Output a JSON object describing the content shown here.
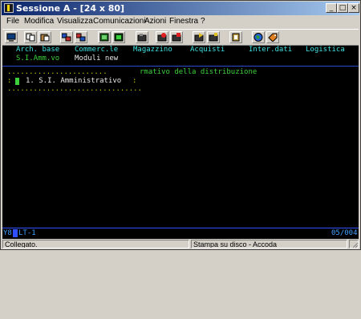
{
  "window": {
    "title": "Sessione A - [24 x 80]",
    "controls": {
      "minimize": "_",
      "maximize": "□",
      "close": "×"
    }
  },
  "menu": [
    {
      "label": "File"
    },
    {
      "label": "Modifica"
    },
    {
      "label": "Visualizza"
    },
    {
      "label": "Comunicazioni"
    },
    {
      "label": "Azioni"
    },
    {
      "label": "Finestra"
    },
    {
      "label": "?"
    }
  ],
  "toolbar": {
    "buttons": [
      "print-screen-icon",
      "copy-icon",
      "paste-icon",
      "send-file-icon",
      "receive-file-icon",
      "display-icon",
      "keyboard-map-icon",
      "macro-icon",
      "record-macro-icon",
      "stop-macro-icon",
      "play-macro-icon",
      "run-macro-icon",
      "clipboard-icon",
      "globe-icon",
      "help-tag-icon"
    ]
  },
  "terminal": {
    "menu_row": [
      "Arch. base",
      "Commerc.le",
      "Magazzino",
      "Acquisti",
      "Inter.dati",
      "Logistica"
    ],
    "submenu_row": [
      "S.I.Amm.vo",
      "Moduli new"
    ],
    "popup_top": ".......................",
    "popup_title_tail": "rmativo della distribuzione",
    "popup_item": "1. S.I. Amministrativo",
    "popup_left_border": ":",
    "popup_right_border": ":",
    "popup_bottom": "...............................",
    "oia_left_a": "Y8",
    "oia_left_b": "LT-1",
    "oia_right": "05/004"
  },
  "status": {
    "connection": "Collegato.",
    "message": "Stampa su disco - Accoda"
  },
  "colors": {
    "titlebar_start": "#0a246a",
    "terminal_bg": "#000000",
    "terminal_green": "#3cd03c",
    "terminal_cyan": "#40e0e0",
    "oia_line": "#3050ff"
  }
}
